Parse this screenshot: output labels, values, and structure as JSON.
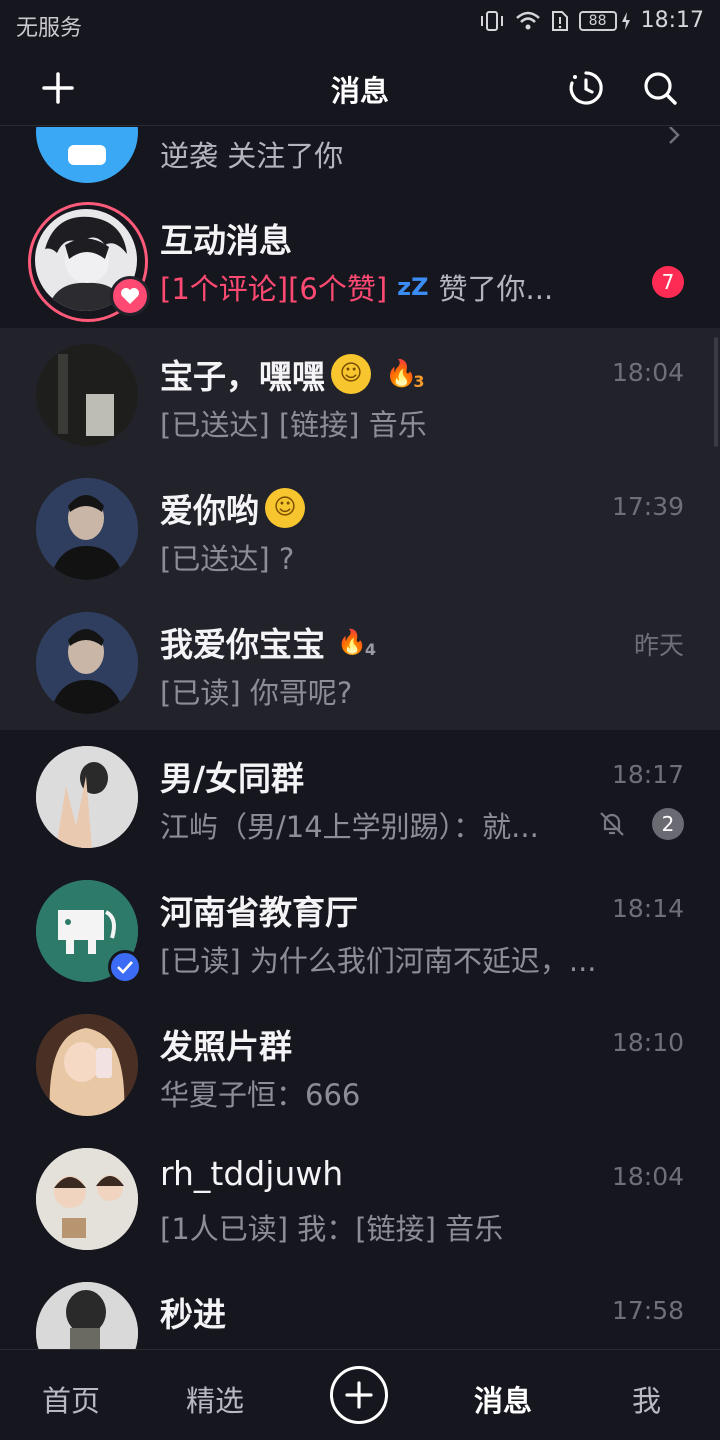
{
  "status_bar": {
    "carrier": "无服务",
    "battery": "88",
    "time": "18:17"
  },
  "header": {
    "title": "消息",
    "icons": [
      "plus-icon",
      "history-icon",
      "search-icon"
    ]
  },
  "partial_top": {
    "preview": "逆袭 关注了你"
  },
  "interaction": {
    "name": "互动消息",
    "preview_red": "[1个评论][6个赞]",
    "preview_grey": "赞了你...",
    "badge": "7"
  },
  "chats": [
    {
      "name": "宝子，嘿嘿",
      "preview": "[已送达] [链接] 音乐",
      "time": "18:04",
      "streak": "3"
    },
    {
      "name": "爱你哟",
      "preview": "[已送达] ?",
      "time": "17:39"
    },
    {
      "name": "我爱你宝宝",
      "preview": "[已读] 你哥呢?",
      "time": "昨天",
      "streak": "4"
    },
    {
      "name": "男/女同群",
      "preview": "江屿（男/14上学别踢）：就...",
      "time": "18:17",
      "badge": "2"
    },
    {
      "name": "河南省教育厅",
      "preview": "[已读] 为什么我们河南不延迟，...",
      "time": "18:14"
    },
    {
      "name": "发照片群",
      "preview": "华夏子恒：666",
      "time": "18:10"
    },
    {
      "name": "rh_tddjuwh",
      "preview": "[1人已读] 我：[链接] 音乐",
      "time": "18:04"
    },
    {
      "name": "秒进",
      "preview": "",
      "time": "17:58"
    }
  ],
  "bottom_nav": {
    "home": "首页",
    "featured": "精选",
    "messages": "消息",
    "me": "我"
  },
  "colors": {
    "background": "#16161e",
    "highlight_row": "#22222b",
    "accent_red": "#fe2c55",
    "verified_blue": "#3c6cf5"
  }
}
